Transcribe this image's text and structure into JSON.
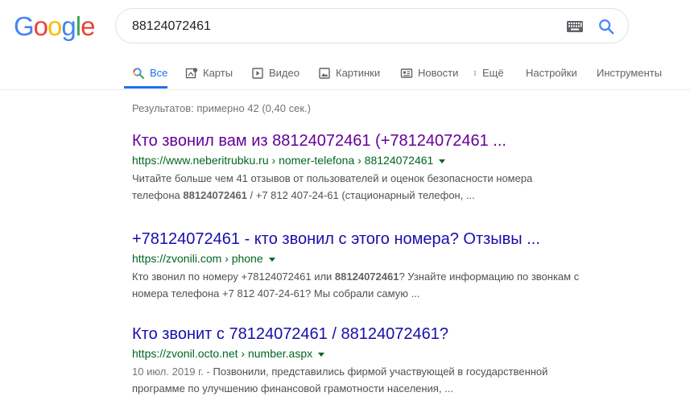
{
  "logo": {
    "letters": [
      "G",
      "o",
      "o",
      "g",
      "l",
      "e"
    ]
  },
  "search": {
    "query": "88124072461"
  },
  "tabs": [
    {
      "label": "Все",
      "icon": "search-icon"
    },
    {
      "label": "Карты",
      "icon": "map-icon"
    },
    {
      "label": "Видео",
      "icon": "video-icon"
    },
    {
      "label": "Картинки",
      "icon": "image-icon"
    },
    {
      "label": "Новости",
      "icon": "news-icon"
    },
    {
      "label": "Ещё",
      "icon": "more-vert-icon"
    },
    {
      "label": "Настройки"
    },
    {
      "label": "Инструменты"
    }
  ],
  "stats": "Результатов: примерно 42 (0,40 сек.)",
  "results": [
    {
      "title": "Кто звонил вам из 88124072461 (+78124072461 ...",
      "url": "https://www.neberitrubku.ru › nomer-telefona › 88124072461",
      "snippet_line1": "Читайте больше чем 41 отзывов от пользователей и оценок безопасности номера",
      "snippet_pre": "телефона ",
      "snippet_bold": "88124072461",
      "snippet_post": " / +7 812 407-24-61 (стационарный телефон,  ..."
    },
    {
      "title": "+78124072461 - кто звонил с этого номера? Отзывы ...",
      "url": "https://zvonili.com › phone",
      "snippet_pre": "Кто звонил по номеру +78124072461 или ",
      "snippet_bold": "88124072461",
      "snippet_post": "? Узнайте информацию по звонкам с",
      "snippet_line2": "номера телефона +7 812 407-24-61? Мы собрали самую ..."
    },
    {
      "title": "Кто звонит с 78124072461 / 88124072461?",
      "url": "https://zvonil.octo.net › number.aspx",
      "date": "10 июл. 2019 г. - ",
      "snippet_line1": "Позвонили, представились фирмой участвующей в государственной",
      "snippet_line2": "программе по улучшению финансовой грамотности населения, ..."
    }
  ]
}
